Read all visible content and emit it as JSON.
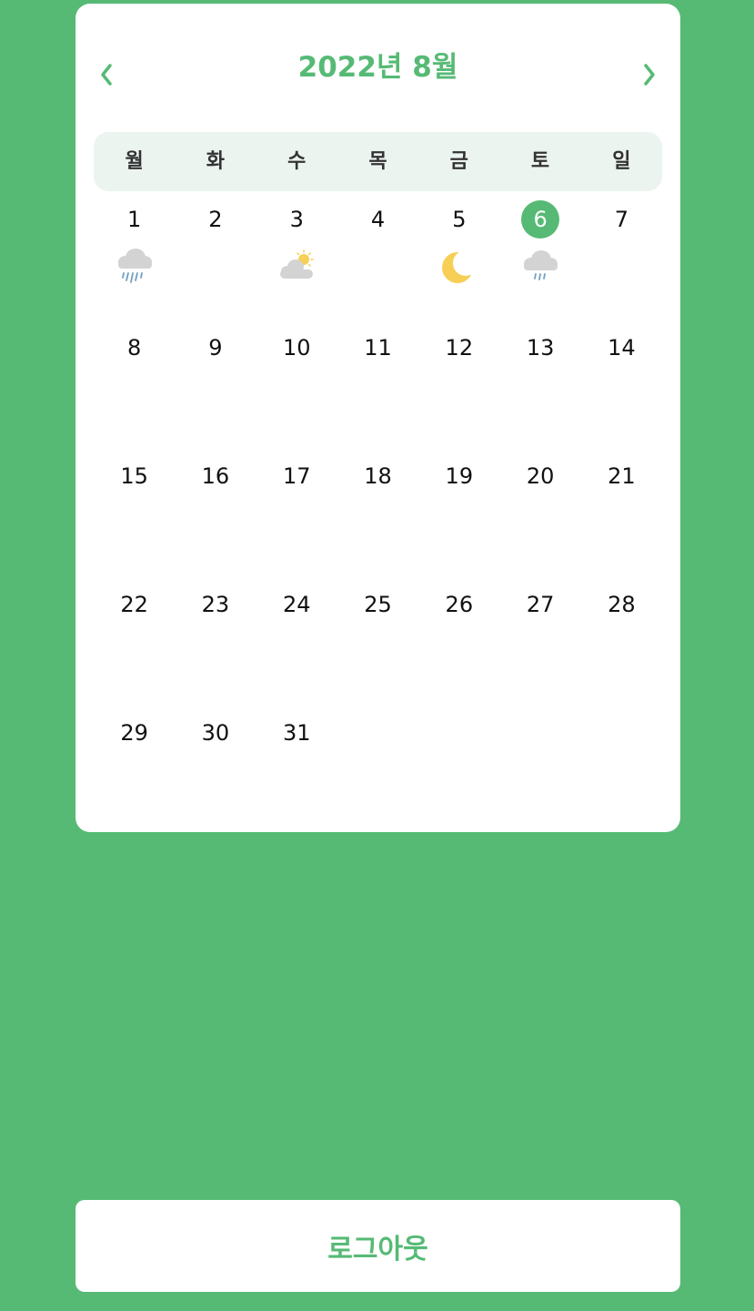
{
  "calendar": {
    "title": "2022년 8월",
    "accent_color": "#56ba75",
    "prev_icon": "chevron-left-icon",
    "next_icon": "chevron-right-icon",
    "weekdays": [
      "월",
      "화",
      "수",
      "목",
      "금",
      "토",
      "일"
    ],
    "today": 6,
    "days": [
      {
        "num": "1",
        "weather": "rain-cloud-icon"
      },
      {
        "num": "2"
      },
      {
        "num": "3",
        "weather": "partly-cloudy-icon"
      },
      {
        "num": "4"
      },
      {
        "num": "5",
        "weather": "moon-icon"
      },
      {
        "num": "6",
        "weather": "light-rain-cloud-icon"
      },
      {
        "num": "7"
      },
      {
        "num": "8"
      },
      {
        "num": "9"
      },
      {
        "num": "10"
      },
      {
        "num": "11"
      },
      {
        "num": "12"
      },
      {
        "num": "13"
      },
      {
        "num": "14"
      },
      {
        "num": "15"
      },
      {
        "num": "16"
      },
      {
        "num": "17"
      },
      {
        "num": "18"
      },
      {
        "num": "19"
      },
      {
        "num": "20"
      },
      {
        "num": "21"
      },
      {
        "num": "22"
      },
      {
        "num": "23"
      },
      {
        "num": "24"
      },
      {
        "num": "25"
      },
      {
        "num": "26"
      },
      {
        "num": "27"
      },
      {
        "num": "28"
      },
      {
        "num": "29"
      },
      {
        "num": "30"
      },
      {
        "num": "31"
      }
    ]
  },
  "logout": {
    "label": "로그아웃"
  }
}
